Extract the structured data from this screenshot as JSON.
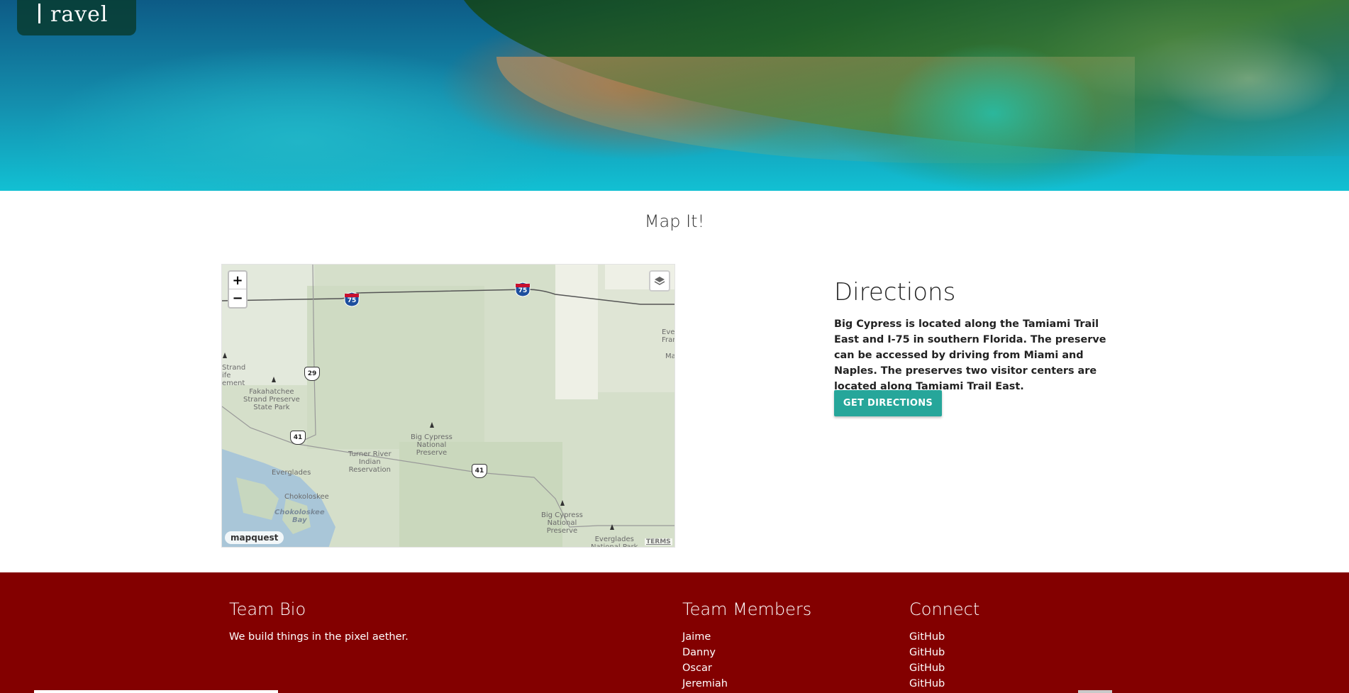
{
  "brand": {
    "logo_text": "ravel"
  },
  "page": {
    "title": "Map It!"
  },
  "map": {
    "zoom_in": "+",
    "zoom_out": "−",
    "attribution_logo": "mapquest",
    "terms_link": "TERMS",
    "road_labels": {
      "i75_a": "75",
      "i75_b": "75",
      "route_29": "29",
      "us41_a": "41",
      "us41_b": "41"
    },
    "place_labels": {
      "strand": "Strand\nife\nement",
      "fakahatchee": "Fakahatchee\nStrand Preserve\nState Park",
      "everglades_city": "Everglades",
      "chokoloskee": "Chokoloskee",
      "chokoloskee_bay": "Chokoloskee\nBay",
      "turner_river": "Turner River\nIndian\nReservation",
      "big_cypress_1": "Big Cypress\nNational\nPreserve",
      "big_cypress_2": "Big Cypress\nNational\nPreserve",
      "everglades_np": "Everglades\nNational Park",
      "ever_fran": "Ever\nFran",
      "ma": "Ma"
    }
  },
  "directions": {
    "heading": "Directions",
    "body": "Big Cypress is located along the Tamiami Trail East and I-75 in southern Florida. The preserve can be accessed by driving from Miami and Naples. The preserves two visitor centers are located along Tamiami Trail East.",
    "button_label": "GET DIRECTIONS"
  },
  "footer": {
    "bio": {
      "heading": "Team Bio",
      "text": "We build things in the pixel aether."
    },
    "members": {
      "heading": "Team Members",
      "items": [
        "Jaime",
        "Danny",
        "Oscar",
        "Jeremiah"
      ]
    },
    "connect": {
      "heading": "Connect",
      "items": [
        "GitHub",
        "GitHub",
        "GitHub",
        "GitHub"
      ]
    }
  },
  "colors": {
    "footer_bg": "#830000",
    "button_bg": "#26a69a",
    "logo_bg": "#083c30"
  }
}
